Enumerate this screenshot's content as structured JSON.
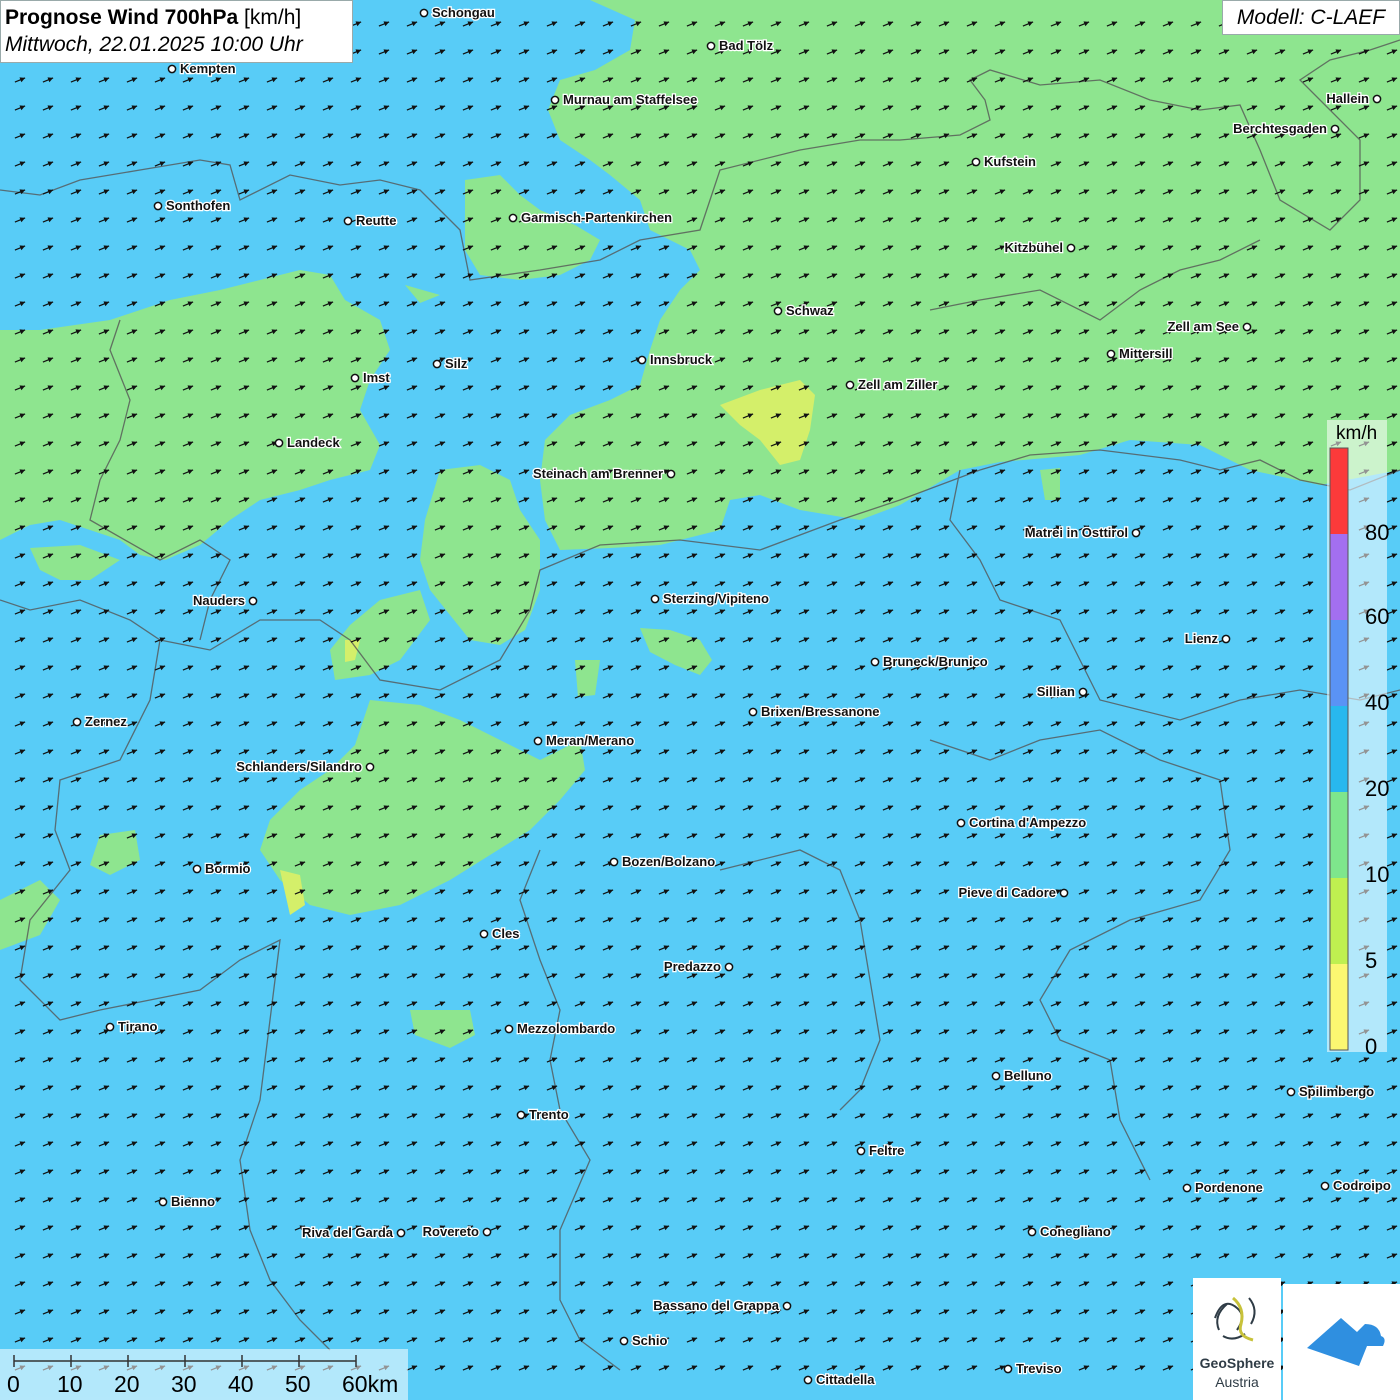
{
  "title": {
    "bold": "Prognose Wind 700hPa",
    "unit": "[km/h]",
    "datetime": "Mittwoch, 22.01.2025 10:00 Uhr"
  },
  "model": "Modell: C-LAEF",
  "legend": {
    "unit": "km/h",
    "ticks": [
      "80",
      "60",
      "40",
      "20",
      "10",
      "5",
      "0"
    ],
    "colors": [
      "#fb3a3a",
      "#a36ff0",
      "#5a93f5",
      "#28b8ee",
      "#7ee68c",
      "#bff050",
      "#fbf771"
    ]
  },
  "scalebar": {
    "labels": [
      "0",
      "10",
      "20",
      "30",
      "40",
      "50",
      "60km"
    ]
  },
  "logos": {
    "geosphere_line1": "GeoSphere",
    "geosphere_line2": "Austria"
  },
  "colors": {
    "wind_10_20": "#58ccf7",
    "wind_5_10": "#8ee58f",
    "wind_0_5": "#d4ef6a",
    "arrow": "#111111",
    "border": "#555555"
  },
  "wind_direction": "east-northeast",
  "cities": [
    {
      "name": "Schongau",
      "label_side": "right"
    },
    {
      "name": "Bad Tölz",
      "label_side": "right"
    },
    {
      "name": "Kempten",
      "label_side": "right"
    },
    {
      "name": "Murnau am Staffelsee",
      "label_side": "right"
    },
    {
      "name": "Hallein",
      "label_side": "left"
    },
    {
      "name": "Berchtesgaden",
      "label_side": "left"
    },
    {
      "name": "Kufstein",
      "label_side": "right"
    },
    {
      "name": "Sonthofen",
      "label_side": "right"
    },
    {
      "name": "Reutte",
      "label_side": "right"
    },
    {
      "name": "Garmisch-Partenkirchen",
      "label_side": "right"
    },
    {
      "name": "Kitzbühel",
      "label_side": "left"
    },
    {
      "name": "Schwaz",
      "label_side": "right"
    },
    {
      "name": "Zell am See",
      "label_side": "left"
    },
    {
      "name": "Mittersill",
      "label_side": "right"
    },
    {
      "name": "Imst",
      "label_side": "right"
    },
    {
      "name": "Silz",
      "label_side": "right"
    },
    {
      "name": "Innsbruck",
      "label_side": "right"
    },
    {
      "name": "Zell am Ziller",
      "label_side": "right"
    },
    {
      "name": "Landeck",
      "label_side": "right"
    },
    {
      "name": "Steinach am Brenner",
      "label_side": "left"
    },
    {
      "name": "Matrei in Osttirol",
      "label_side": "left"
    },
    {
      "name": "Nauders",
      "label_side": "left"
    },
    {
      "name": "Sterzing/Vipiteno",
      "label_side": "right"
    },
    {
      "name": "Lienz",
      "label_side": "left"
    },
    {
      "name": "Bruneck/Brunico",
      "label_side": "right"
    },
    {
      "name": "Sillian",
      "label_side": "left"
    },
    {
      "name": "Zernez",
      "label_side": "right"
    },
    {
      "name": "Brixen/Bressanone",
      "label_side": "right"
    },
    {
      "name": "Meran/Merano",
      "label_side": "right"
    },
    {
      "name": "Schlanders/Silandro",
      "label_side": "left"
    },
    {
      "name": "Cortina d'Ampezzo",
      "label_side": "right"
    },
    {
      "name": "Bozen/Bolzano",
      "label_side": "right"
    },
    {
      "name": "Bormio",
      "label_side": "right"
    },
    {
      "name": "Pieve di Cadore",
      "label_side": "left"
    },
    {
      "name": "Cles",
      "label_side": "right"
    },
    {
      "name": "Predazzo",
      "label_side": "left"
    },
    {
      "name": "Tirano",
      "label_side": "right"
    },
    {
      "name": "Mezzolombardo",
      "label_side": "right"
    },
    {
      "name": "Belluno",
      "label_side": "right"
    },
    {
      "name": "Spilimbergo",
      "label_side": "right"
    },
    {
      "name": "Trento",
      "label_side": "right"
    },
    {
      "name": "Feltre",
      "label_side": "right"
    },
    {
      "name": "Pordenone",
      "label_side": "right"
    },
    {
      "name": "Codroipo",
      "label_side": "right"
    },
    {
      "name": "Bienno",
      "label_side": "right"
    },
    {
      "name": "Riva del Garda",
      "label_side": "left"
    },
    {
      "name": "Rovereto",
      "label_side": "left"
    },
    {
      "name": "Conegliano",
      "label_side": "right"
    },
    {
      "name": "Bassano del Grappa",
      "label_side": "left"
    },
    {
      "name": "Schio",
      "label_side": "right"
    },
    {
      "name": "Treviso",
      "label_side": "right"
    },
    {
      "name": "Cittadella",
      "label_side": "right"
    }
  ]
}
